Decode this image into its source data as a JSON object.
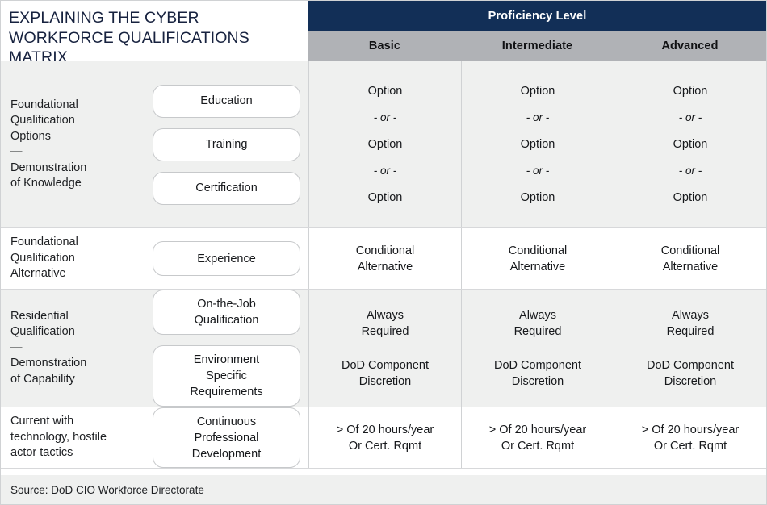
{
  "title": "EXPLAINING THE CYBER WORKFORCE QUALIFICATIONS MATRIX",
  "header": {
    "group_label": "Proficiency Level",
    "levels": [
      "Basic",
      "Intermediate",
      "Advanced"
    ]
  },
  "colors": {
    "header_navy": "#122f57",
    "header_gray": "#b0b2b6",
    "row_gray": "#eff0ef",
    "row_white": "#ffffff",
    "title_navy": "#17223f",
    "border": "#d0d2d4"
  },
  "rows": [
    {
      "label_lines": [
        "Foundational",
        "Qualification",
        "Options"
      ],
      "label_dash": "—",
      "label_lines2": [
        "Demonstration",
        "of Knowledge"
      ],
      "pills": [
        "Education",
        "Training",
        "Certification"
      ],
      "shade": "gray",
      "cell_segments": [
        "Option",
        "- or -",
        "Option",
        "- or -",
        "Option"
      ],
      "cell_styles": [
        "plain",
        "or",
        "plain",
        "or",
        "plain"
      ]
    },
    {
      "label_lines": [
        "Foundational",
        "Qualification",
        "Alternative"
      ],
      "label_dash": "",
      "label_lines2": [],
      "pills": [
        "Experience"
      ],
      "shade": "white",
      "cell_segments": [
        "Conditional\nAlternative"
      ],
      "cell_styles": [
        "plain"
      ]
    },
    {
      "label_lines": [
        "Residential",
        "Qualification"
      ],
      "label_dash": "—",
      "label_lines2": [
        "Demonstration",
        "of Capability"
      ],
      "pills": [
        "On-the-Job\nQualification",
        "Environment\nSpecific\nRequirements"
      ],
      "shade": "gray",
      "cell_segments": [
        "Always\nRequired",
        "DoD Component\nDiscretion"
      ],
      "cell_styles": [
        "plain",
        "plain"
      ]
    },
    {
      "label_lines": [
        "Current with",
        "technology, hostile",
        "actor tactics"
      ],
      "label_dash": "",
      "label_lines2": [],
      "pills": [
        "Continuous\nProfessional\nDevelopment"
      ],
      "shade": "white",
      "cell_segments": [
        "> Of 20 hours/year\nOr Cert. Rqmt"
      ],
      "cell_styles": [
        "plain"
      ]
    }
  ],
  "footer": {
    "source": "Source: DoD CIO Workforce Directorate"
  }
}
